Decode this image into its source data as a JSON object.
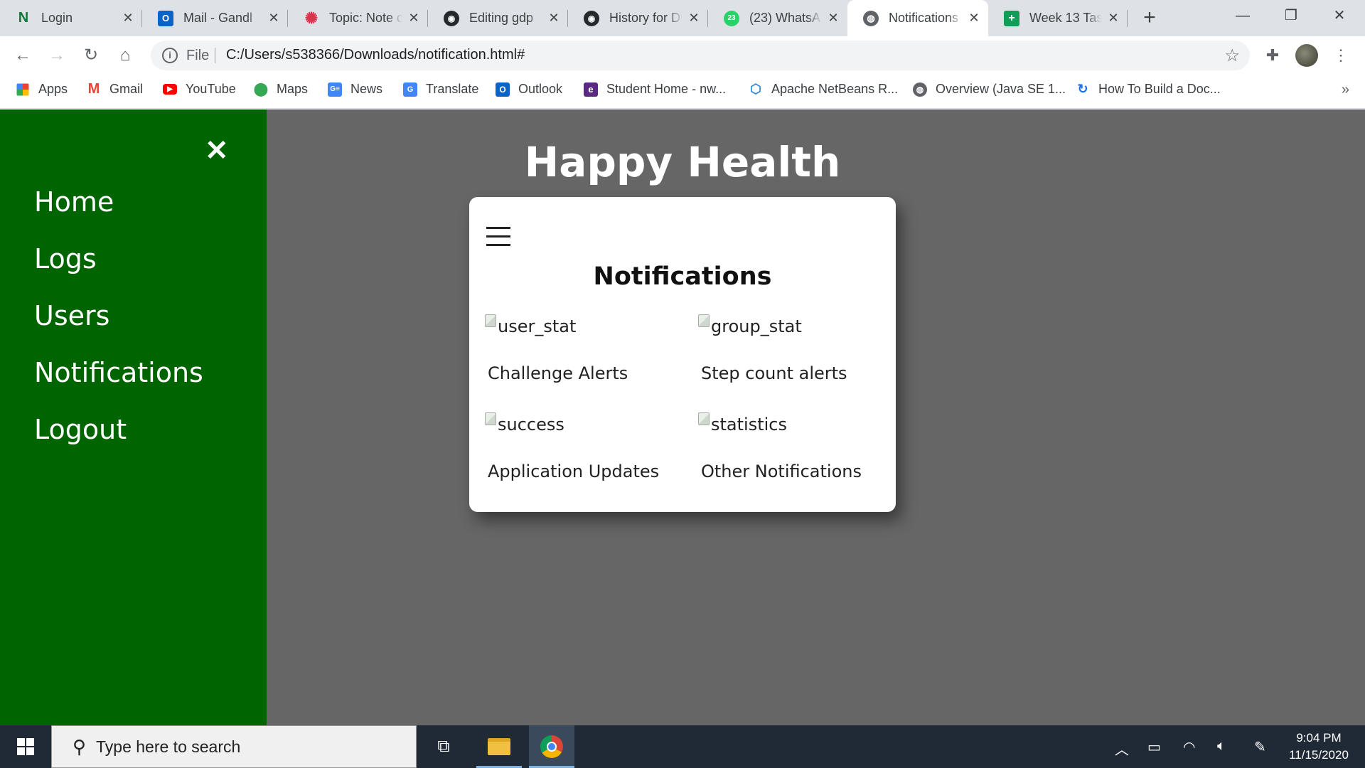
{
  "browser": {
    "tabs": [
      {
        "title": "Login",
        "icon": "n-icon",
        "active": false
      },
      {
        "title": "Mail - Gandl",
        "icon": "outlook-icon",
        "active": false
      },
      {
        "title": "Topic: Note c",
        "icon": "topic-icon",
        "active": false
      },
      {
        "title": "Editing gdp",
        "icon": "github-icon",
        "active": false
      },
      {
        "title": "History for D",
        "icon": "github-icon",
        "active": false
      },
      {
        "title": "(23) WhatsA",
        "icon": "whatsapp-icon",
        "active": false
      },
      {
        "title": "Notifications",
        "icon": "globe-icon",
        "active": true
      },
      {
        "title": "Week 13 Tas",
        "icon": "sheets-icon",
        "active": false
      }
    ],
    "address": {
      "scheme": "File",
      "url": "C:/Users/s538366/Downloads/notification.html#"
    },
    "bookmarks": [
      {
        "label": "Apps"
      },
      {
        "label": "Gmail"
      },
      {
        "label": "YouTube"
      },
      {
        "label": "Maps"
      },
      {
        "label": "News"
      },
      {
        "label": "Translate"
      },
      {
        "label": "Outlook"
      },
      {
        "label": "Student Home - nw..."
      },
      {
        "label": "Apache NetBeans R..."
      },
      {
        "label": "Overview (Java SE 1..."
      },
      {
        "label": "How To Build a Doc..."
      }
    ],
    "bookmarks_more": "»"
  },
  "sidebar": {
    "close_symbol": "✕",
    "items": [
      {
        "label": "Home"
      },
      {
        "label": "Logs"
      },
      {
        "label": "Users"
      },
      {
        "label": "Notifications"
      },
      {
        "label": "Logout"
      }
    ]
  },
  "page": {
    "title": "Happy Health",
    "card": {
      "title": "Notifications",
      "items": [
        {
          "alt": "user_stat",
          "label": "Challenge Alerts"
        },
        {
          "alt": "group_stat",
          "label": "Step count alerts"
        },
        {
          "alt": "success",
          "label": "Application Updates"
        },
        {
          "alt": "statistics",
          "label": "Other Notifications"
        }
      ]
    }
  },
  "taskbar": {
    "search_placeholder": "Type here to search",
    "clock_time": "9:04 PM",
    "clock_date": "11/15/2020"
  },
  "colors": {
    "sidebar_bg": "#006400",
    "overlay_bg": "#666666",
    "taskbar_bg": "#1f2a36"
  }
}
